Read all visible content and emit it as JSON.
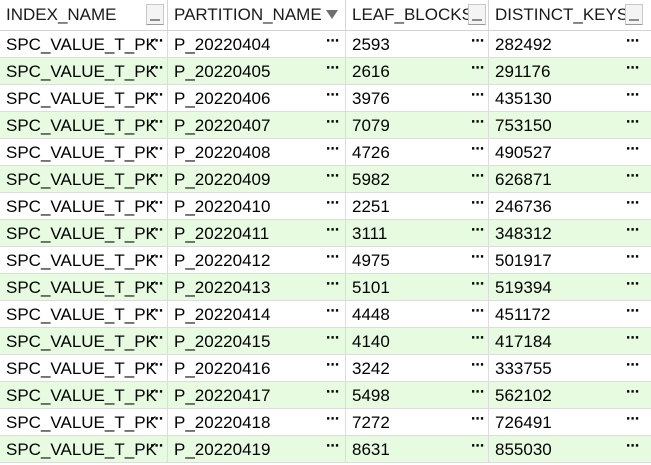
{
  "columns": [
    "INDEX_NAME",
    "PARTITION_NAME",
    "LEAF_BLOCKS",
    "DISTINCT_KEYS"
  ],
  "ellipsis_glyph": "⋯",
  "rows": [
    [
      "SPC_VALUE_T_PK",
      "P_20220404",
      "2593",
      "282492"
    ],
    [
      "SPC_VALUE_T_PK",
      "P_20220405",
      "2616",
      "291176"
    ],
    [
      "SPC_VALUE_T_PK",
      "P_20220406",
      "3976",
      "435130"
    ],
    [
      "SPC_VALUE_T_PK",
      "P_20220407",
      "7079",
      "753150"
    ],
    [
      "SPC_VALUE_T_PK",
      "P_20220408",
      "4726",
      "490527"
    ],
    [
      "SPC_VALUE_T_PK",
      "P_20220409",
      "5982",
      "626871"
    ],
    [
      "SPC_VALUE_T_PK",
      "P_20220410",
      "2251",
      "246736"
    ],
    [
      "SPC_VALUE_T_PK",
      "P_20220411",
      "3111",
      "348312"
    ],
    [
      "SPC_VALUE_T_PK",
      "P_20220412",
      "4975",
      "501917"
    ],
    [
      "SPC_VALUE_T_PK",
      "P_20220413",
      "5101",
      "519394"
    ],
    [
      "SPC_VALUE_T_PK",
      "P_20220414",
      "4448",
      "451172"
    ],
    [
      "SPC_VALUE_T_PK",
      "P_20220415",
      "4140",
      "417184"
    ],
    [
      "SPC_VALUE_T_PK",
      "P_20220416",
      "3242",
      "333755"
    ],
    [
      "SPC_VALUE_T_PK",
      "P_20220417",
      "5498",
      "562102"
    ],
    [
      "SPC_VALUE_T_PK",
      "P_20220418",
      "7272",
      "726491"
    ],
    [
      "SPC_VALUE_T_PK",
      "P_20220419",
      "8631",
      "855030"
    ]
  ],
  "colors": {
    "alt_row": "#e6fbdf",
    "grid_line": "#dcdcdc",
    "header_bg": "#ffffff"
  },
  "icons": {
    "header_button": "column-menu-icon",
    "sort": "sort-down-icon",
    "cell_more": "ellipsis-icon"
  }
}
